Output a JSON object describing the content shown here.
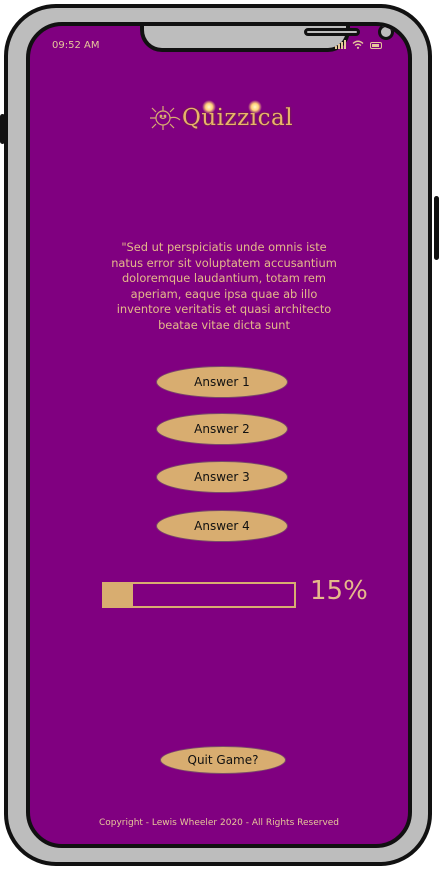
{
  "status_bar": {
    "time": "09:52 AM",
    "icons": [
      "signal-icon",
      "wifi-icon",
      "battery-icon"
    ]
  },
  "logo": {
    "title": "Quizzical",
    "icon": "lion-icon"
  },
  "question": {
    "text": "\"Sed ut perspiciatis unde omnis iste natus error sit voluptatem accusantium doloremque laudantium, totam rem aperiam, eaque ipsa quae ab illo inventore veritatis et quasi architecto beatae vitae dicta sunt"
  },
  "answers": [
    {
      "label": "Answer 1"
    },
    {
      "label": "Answer 2"
    },
    {
      "label": "Answer 3"
    },
    {
      "label": "Answer 4"
    }
  ],
  "progress": {
    "value": 0.15,
    "label": "15%"
  },
  "quit": {
    "label": "Quit Game?"
  },
  "footer": {
    "copyright": "Copyright - Lewis Wheeler 2020 - All Rights Reserved"
  },
  "colors": {
    "background": "#800080",
    "accent": "#d8ad70",
    "text": "#e4b98a"
  }
}
